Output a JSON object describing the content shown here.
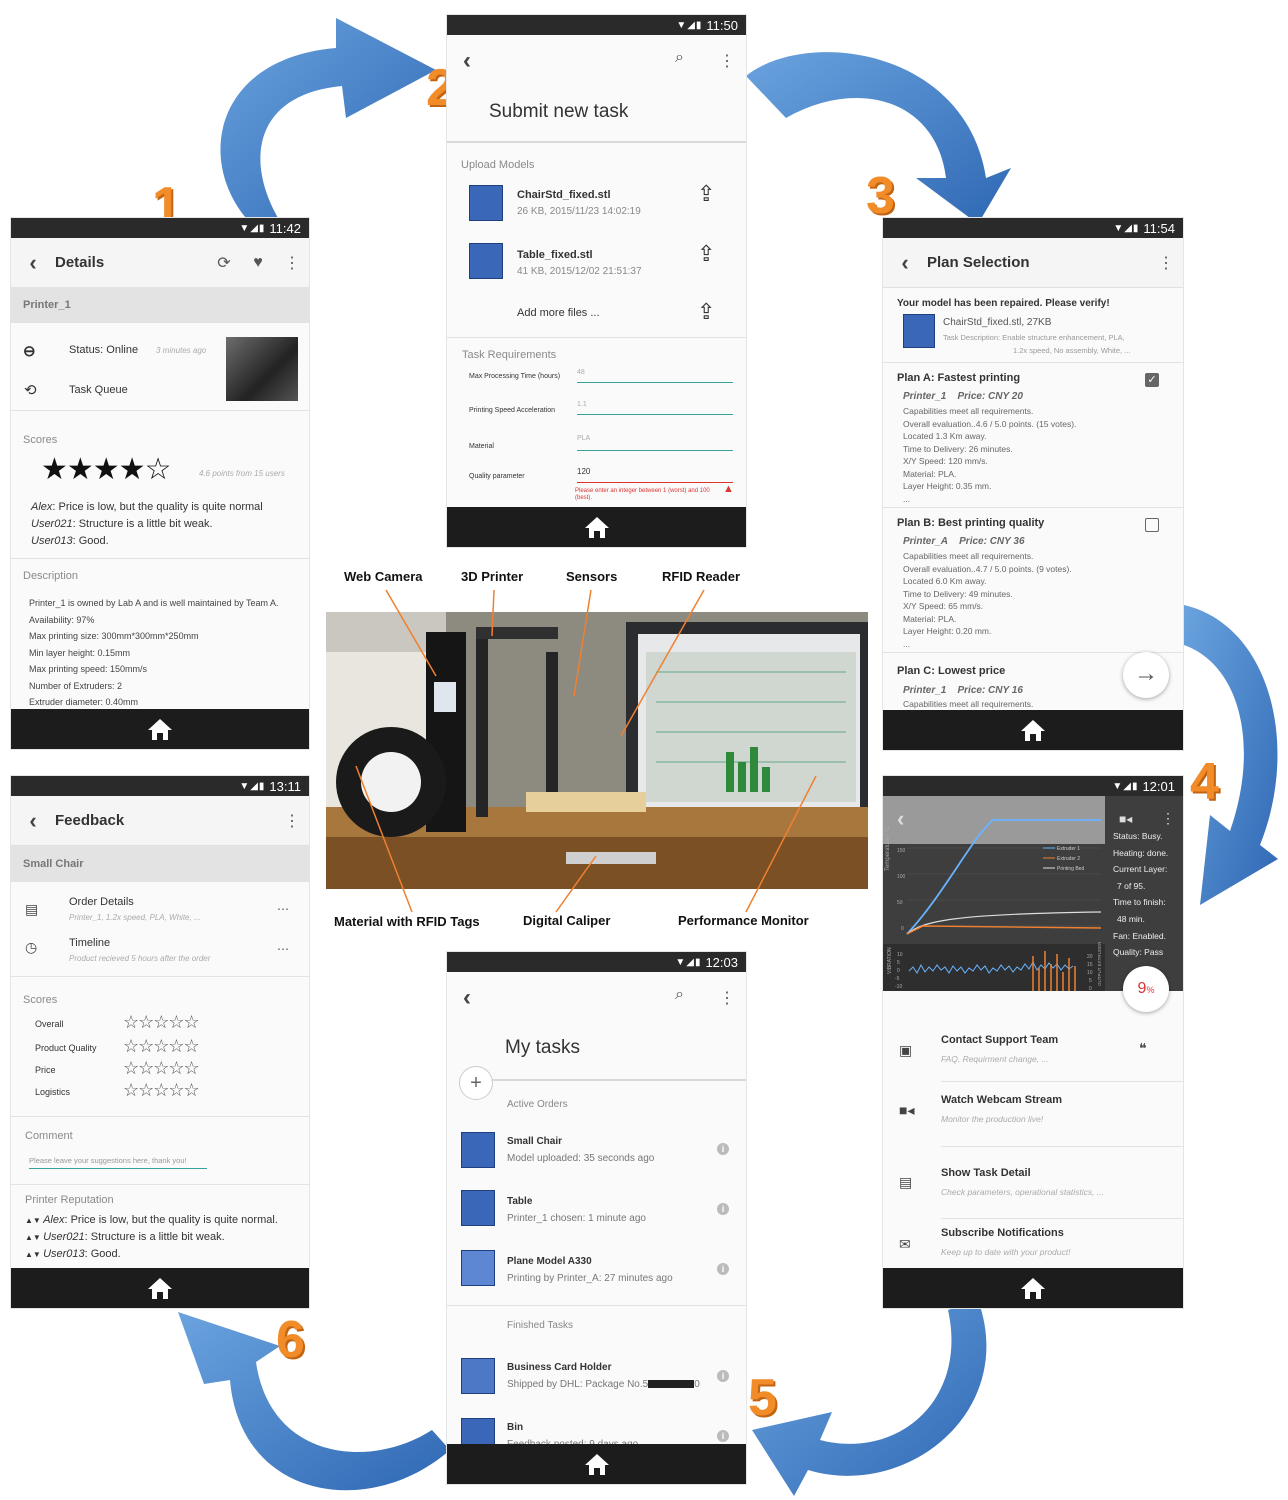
{
  "step_numbers": [
    "1",
    "2",
    "3",
    "4",
    "5",
    "6"
  ],
  "screen1": {
    "time": "11:42",
    "title": "Details",
    "printer": "Printer_1",
    "status": "Status: Online",
    "status_time": "3 minutes ago",
    "task_queue": "Task Queue",
    "scores_label": "Scores",
    "stars": "★★★★☆",
    "rating_note": "4.6 points from 15 users",
    "reviews": [
      {
        "user": "Alex",
        "text": ": Price is low, but the quality is quite normal"
      },
      {
        "user": "User021",
        "text": ": Structure is a little bit weak."
      },
      {
        "user": "User013",
        "text": ": Good."
      }
    ],
    "desc_label": "Description",
    "desc_lines": [
      "Printer_1 is owned by Lab A and is well maintained by Team A.",
      "Availability: 97%",
      "Max printing size: 300mm*300mm*250mm",
      "Min layer height: 0.15mm",
      "Max printing speed: 150mm/s",
      "Number of Extruders: 2",
      "Extruder diameter: 0.40mm"
    ]
  },
  "screen2": {
    "time": "11:50",
    "title": "Submit new task",
    "upload_label": "Upload Models",
    "files": [
      {
        "name": "ChairStd_fixed.stl",
        "meta": "26 KB, 2015/11/23 14:02:19"
      },
      {
        "name": "Table_fixed.stl",
        "meta": "41 KB, 2015/12/02 21:51:37"
      }
    ],
    "add_more": "Add more files ...",
    "req_label": "Task Requirements",
    "fields": [
      {
        "label": "Max Processing Time (hours)",
        "value": "48"
      },
      {
        "label": "Printing Speed Acceleration",
        "value": "1.1"
      },
      {
        "label": "Material",
        "value": "PLA"
      },
      {
        "label": "Quality parameter",
        "value": "120"
      }
    ],
    "error": "Please enter an integer between 1 (worst) and 100 (best)."
  },
  "screen3": {
    "time": "11:54",
    "title": "Plan Selection",
    "repaired": "Your model has been repaired. Please verify!",
    "model": "ChairStd_fixed.stl, 27KB",
    "task_desc1": "Task Description: Enable structure enhancement, PLA,",
    "task_desc2": "1.2x speed, No assembly, White, ...",
    "plans": [
      {
        "title": "Plan A: Fastest printing",
        "printer": "Printer_1",
        "price": "Price: CNY 20",
        "lines": [
          "Capabilities meet all requirements.",
          "Overall evaluation..4.6 / 5.0 points. (15 votes).",
          "Located 1.3 Km away.",
          "Time to Delivery: 26 minutes.",
          "X/Y Speed: 120 mm/s.",
          "Material: PLA.",
          "Layer Height: 0.35 mm.",
          "..."
        ]
      },
      {
        "title": "Plan B: Best printing quality",
        "printer": "Printer_A",
        "price": "Price: CNY 36",
        "lines": [
          "Capabilities meet all requirements.",
          "Overall evaluation..4.7 / 5.0 points. (9 votes).",
          "Located 6.0 Km away.",
          "Time to Delivery: 49 minutes.",
          "X/Y Speed: 65 mm/s.",
          "Material: PLA.",
          "Layer Height: 0.20 mm.",
          "..."
        ]
      },
      {
        "title": "Plan C: Lowest price",
        "printer": "Printer_1",
        "price": "Price: CNY 16",
        "lines": [
          "Capabilities meet all requirements."
        ]
      }
    ]
  },
  "screen4": {
    "time": "12:01",
    "status": [
      "Status: Busy.",
      "Heating: done.",
      "Current Layer:",
      "7 of 95.",
      "Time to finish:",
      "48 min.",
      "Fan: Enabled.",
      "Quality: Pass"
    ],
    "progress": "9",
    "progress_unit": "%",
    "progress_fraction": 0.09,
    "legend": [
      "Extruder 1",
      "Extruder 2",
      "Printing Bed"
    ],
    "axis_top": [
      "150",
      "100",
      "50",
      "0"
    ],
    "y_label": "Temperature / °C",
    "vib_label": "VIBRATION",
    "out_label": "OUTPUT EXTRUDER",
    "vib_ticks": [
      "10",
      "5",
      "0",
      "-5",
      "-10",
      "-15"
    ],
    "out_ticks": [
      "20",
      "15",
      "10",
      "5",
      "0"
    ],
    "actions": [
      {
        "title": "Contact Support Team",
        "sub": "FAQ, Requirment change, ..."
      },
      {
        "title": "Watch Webcam Stream",
        "sub": "Monitor the production live!"
      },
      {
        "title": "Show Task Detail",
        "sub": "Check parameters, operational statistics, ..."
      },
      {
        "title": "Subscribe Notifications",
        "sub": "Keep up to date with your product!"
      }
    ]
  },
  "screen5": {
    "time": "12:03",
    "title": "My tasks",
    "active_label": "Active Orders",
    "active": [
      {
        "name": "Small Chair",
        "status": "Model uploaded: 35 seconds ago"
      },
      {
        "name": "Table",
        "status": "Printer_1 chosen: 1 minute ago"
      },
      {
        "name": "Plane Model A330",
        "status": "Printing by Printer_A: 27 minutes ago"
      }
    ],
    "finished_label": "Finished Tasks",
    "finished": [
      {
        "name": "Business Card Holder",
        "status": "Shipped by DHL: Package No.5"
      },
      {
        "name": "Bin",
        "status": "Feedback posted: 9 days ago"
      }
    ],
    "trailing": "0"
  },
  "screen6": {
    "time": "13:11",
    "title": "Feedback",
    "item": "Small Chair",
    "order": "Order Details",
    "order_sub": "Printer_1, 1.2x speed, PLA, White, ...",
    "timeline": "Timeline",
    "timeline_sub": "Product recieved 5 hours after the order",
    "scores_label": "Scores",
    "score_rows": [
      "Overall",
      "Product Quality",
      "Price",
      "Logistics"
    ],
    "empty_stars": "☆☆☆☆☆",
    "comment_label": "Comment",
    "comment_placeholder": "Please leave your suggestions here, thank you!",
    "rep_label": "Printer Reputation",
    "reviews": [
      {
        "user": "Alex",
        "text": ": Price is low, but the quality is quite normal."
      },
      {
        "user": "User021",
        "text": ": Structure is a little bit weak."
      },
      {
        "user": "User013",
        "text": ": Good."
      }
    ]
  },
  "photo_labels": {
    "webcam": "Web Camera",
    "printer": "3D Printer",
    "sensors": "Sensors",
    "rfid": "RFID Reader",
    "material": "Material with RFID Tags",
    "caliper": "Digital Caliper",
    "monitor": "Performance Monitor"
  },
  "colors": {
    "arrow": "#3b79c6",
    "number": "#f28c28",
    "accent": "#3aa09a"
  }
}
